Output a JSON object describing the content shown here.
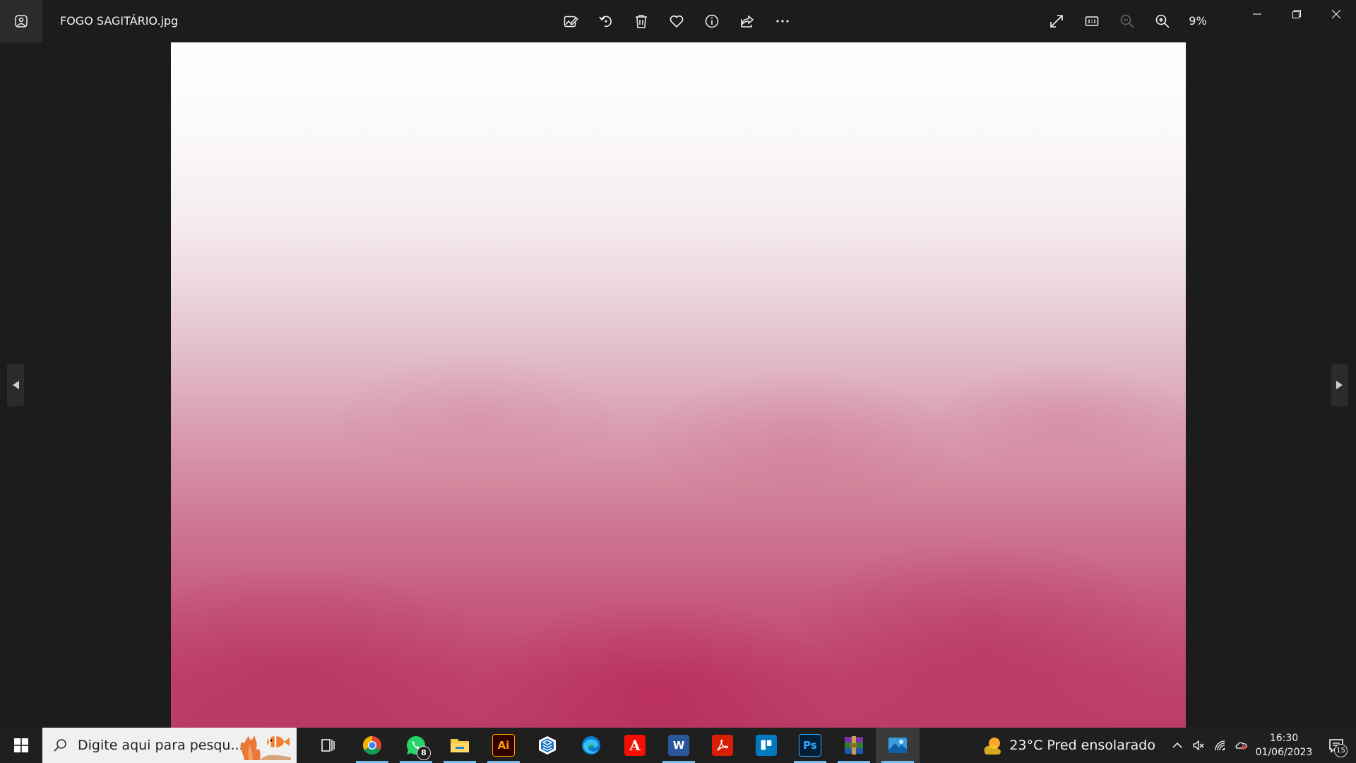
{
  "window": {
    "filename": "FOGO SAGITÁRIO.jpg",
    "zoom_label": "9%"
  },
  "toolbar": {
    "icons": [
      "edit-image-icon",
      "rotate-icon",
      "delete-icon",
      "favorite-icon",
      "info-icon",
      "share-icon",
      "more-icon"
    ],
    "view_icons": [
      "fullscreen-icon",
      "actual-size-icon",
      "zoom-out-icon",
      "zoom-in-icon"
    ]
  },
  "taskbar": {
    "search_placeholder": "Digite aqui para pesqu...",
    "apps": [
      {
        "name": "chrome",
        "label": ""
      },
      {
        "name": "whatsapp",
        "label": "",
        "badge": "8"
      },
      {
        "name": "file-explorer",
        "label": ""
      },
      {
        "name": "illustrator",
        "label": "Ai"
      },
      {
        "name": "sketchup",
        "label": ""
      },
      {
        "name": "edge",
        "label": ""
      },
      {
        "name": "acrobat-reader",
        "label": "A"
      },
      {
        "name": "word",
        "label": "W"
      },
      {
        "name": "acrobat",
        "label": ""
      },
      {
        "name": "trello",
        "label": ""
      },
      {
        "name": "photoshop",
        "label": "Ps"
      },
      {
        "name": "winrar",
        "label": ""
      },
      {
        "name": "photos",
        "label": ""
      }
    ],
    "weather": "23°C  Pred ensolarado",
    "time": "16:30",
    "date": "01/06/2023",
    "notification_count": "15"
  },
  "colors": {
    "accent": "#76b9ed",
    "titlebar_bg": "#1c1c1c",
    "taskbar_bg": "#1f1f1f"
  }
}
